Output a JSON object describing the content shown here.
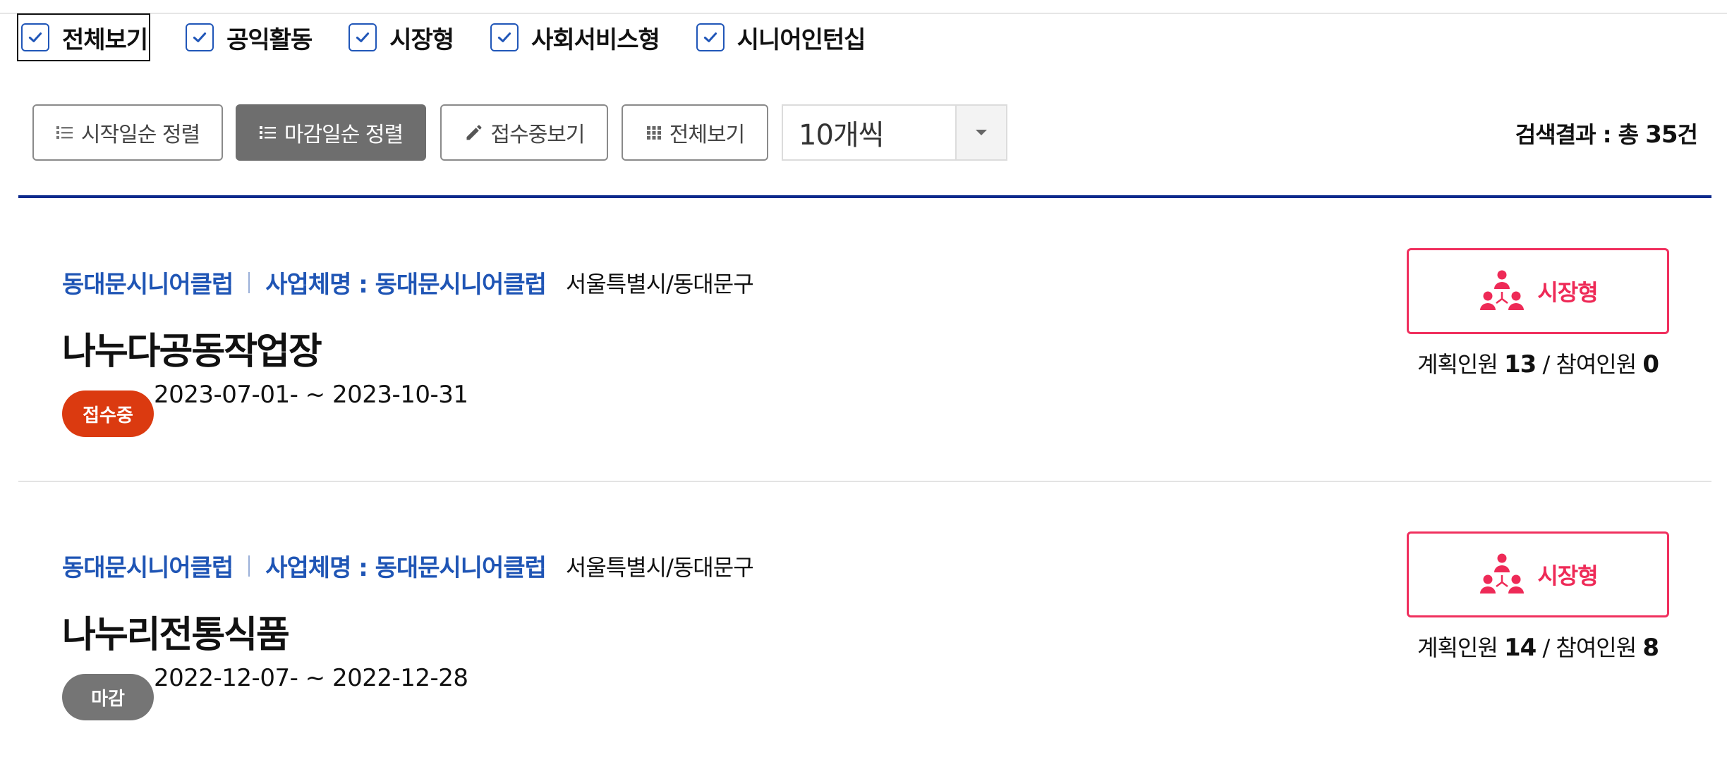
{
  "filters": [
    {
      "label": "전체보기",
      "checked": true
    },
    {
      "label": "공익활동",
      "checked": true
    },
    {
      "label": "시장형",
      "checked": true
    },
    {
      "label": "사회서비스형",
      "checked": true
    },
    {
      "label": "시니어인턴십",
      "checked": true
    }
  ],
  "toolbar": {
    "sort_start": "시작일순 정렬",
    "sort_deadline": "마감일순 정렬",
    "view_open": "접수중보기",
    "view_all": "전체보기",
    "page_size": "10개씩",
    "result_prefix": "검색결과 : 총",
    "result_count": "35",
    "result_suffix": "건"
  },
  "colors": {
    "accent_blue": "#1f55b5",
    "divider_navy": "#0c2a8c",
    "badge_open": "#db3a10",
    "badge_closed": "#757575",
    "type_pink": "#ee2a57"
  },
  "items": [
    {
      "org": "동대문시니어클럽",
      "biz": "사업체명 : 동대문시니어클럽",
      "region": "서울특별시/동대문구",
      "title": "나누다공동작업장",
      "status": "접수중",
      "period": "2023-07-01- ~ 2023-10-31",
      "type": "시장형",
      "type_icon": "group-people-icon",
      "planned_label": "계획인원",
      "planned": "13",
      "participants_label": "참여인원",
      "participants": "0"
    },
    {
      "org": "동대문시니어클럽",
      "biz": "사업체명 : 동대문시니어클럽",
      "region": "서울특별시/동대문구",
      "title": "나누리전통식품",
      "status": "마감",
      "period": "2022-12-07- ~ 2022-12-28",
      "type": "시장형",
      "type_icon": "group-people-icon",
      "planned_label": "계획인원",
      "planned": "14",
      "participants_label": "참여인원",
      "participants": "8"
    }
  ]
}
